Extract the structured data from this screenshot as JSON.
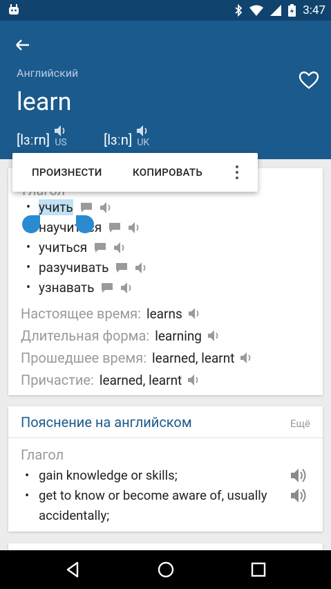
{
  "status_bar": {
    "time": "3:47",
    "icons": [
      "android-debug-icon",
      "bluetooth-icon",
      "wifi-icon",
      "cell-signal-icon",
      "battery-charging-icon"
    ]
  },
  "header": {
    "language": "Английский",
    "word": "learn",
    "pronunciations": [
      {
        "ipa": "[lɜːrn]",
        "code": "US"
      },
      {
        "ipa": "[lɜːn]",
        "code": "UK"
      }
    ]
  },
  "context_menu": {
    "items": [
      "ПРОИЗНЕСТИ",
      "КОПИРОВАТЬ"
    ]
  },
  "translation_card": {
    "part_of_speech": "Глагол",
    "translations": [
      "учить",
      "научиться",
      "учиться",
      "разучивать",
      "узнавать"
    ],
    "forms": [
      {
        "label": "Настоящее время:",
        "value": "learns"
      },
      {
        "label": "Длительная форма:",
        "value": "learning"
      },
      {
        "label": "Прошедшее время:",
        "value": "learned, learnt"
      },
      {
        "label": "Причастие:",
        "value": "learned, learnt"
      }
    ]
  },
  "english_card": {
    "title": "Пояснение на английском",
    "more": "Ещё",
    "part_of_speech": "Глагол",
    "definitions": [
      "gain knowledge or skills;",
      "get to know or become aware of, usually accidentally;"
    ]
  },
  "colors": {
    "header": "#1b5a8c",
    "status_bar": "#10446e",
    "selection": "#bfe0f5",
    "handle": "#2a8bd1"
  }
}
